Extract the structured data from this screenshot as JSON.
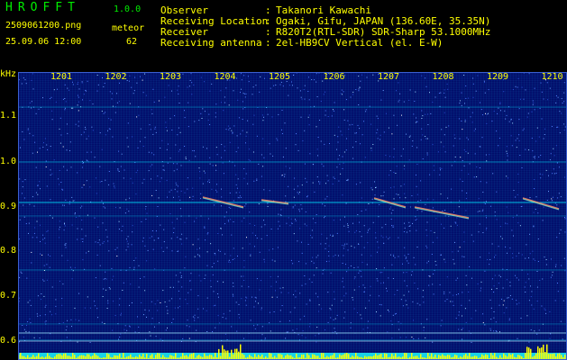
{
  "app": {
    "name": "HROFFT",
    "version": "1.0.0"
  },
  "file": {
    "name": "2509061200.png",
    "timestamp": "25.09.06 12:00"
  },
  "meteor": {
    "label": "meteor",
    "count": "62"
  },
  "info": [
    {
      "label": "Observer",
      "value": "Takanori Kawachi"
    },
    {
      "label": "Receiving Location",
      "value": "Ogaki, Gifu, JAPAN (136.60E, 35.35N)"
    },
    {
      "label": "Receiver",
      "value": "R820T2(RTL-SDR) SDR-Sharp 53.1000MHz"
    },
    {
      "label": "Receiving antenna",
      "value": "2el-HB9CV Vertical (el. E-W)"
    }
  ],
  "separator": ":",
  "y_unit": "kHz",
  "y_ticks": [
    "1.1",
    "1.0",
    "0.9",
    "0.8",
    "0.7",
    "0.6"
  ],
  "x_ticks": [
    "1201",
    "1202",
    "1203",
    "1204",
    "1205",
    "1206",
    "1207",
    "1208",
    "1209",
    "1210"
  ],
  "colors": {
    "background": "#000000",
    "text": "#ffff00",
    "title": "#00ee00",
    "plot_bg": "#000e6a",
    "signal": "#00ffff",
    "histogram": "#ffff00"
  }
}
